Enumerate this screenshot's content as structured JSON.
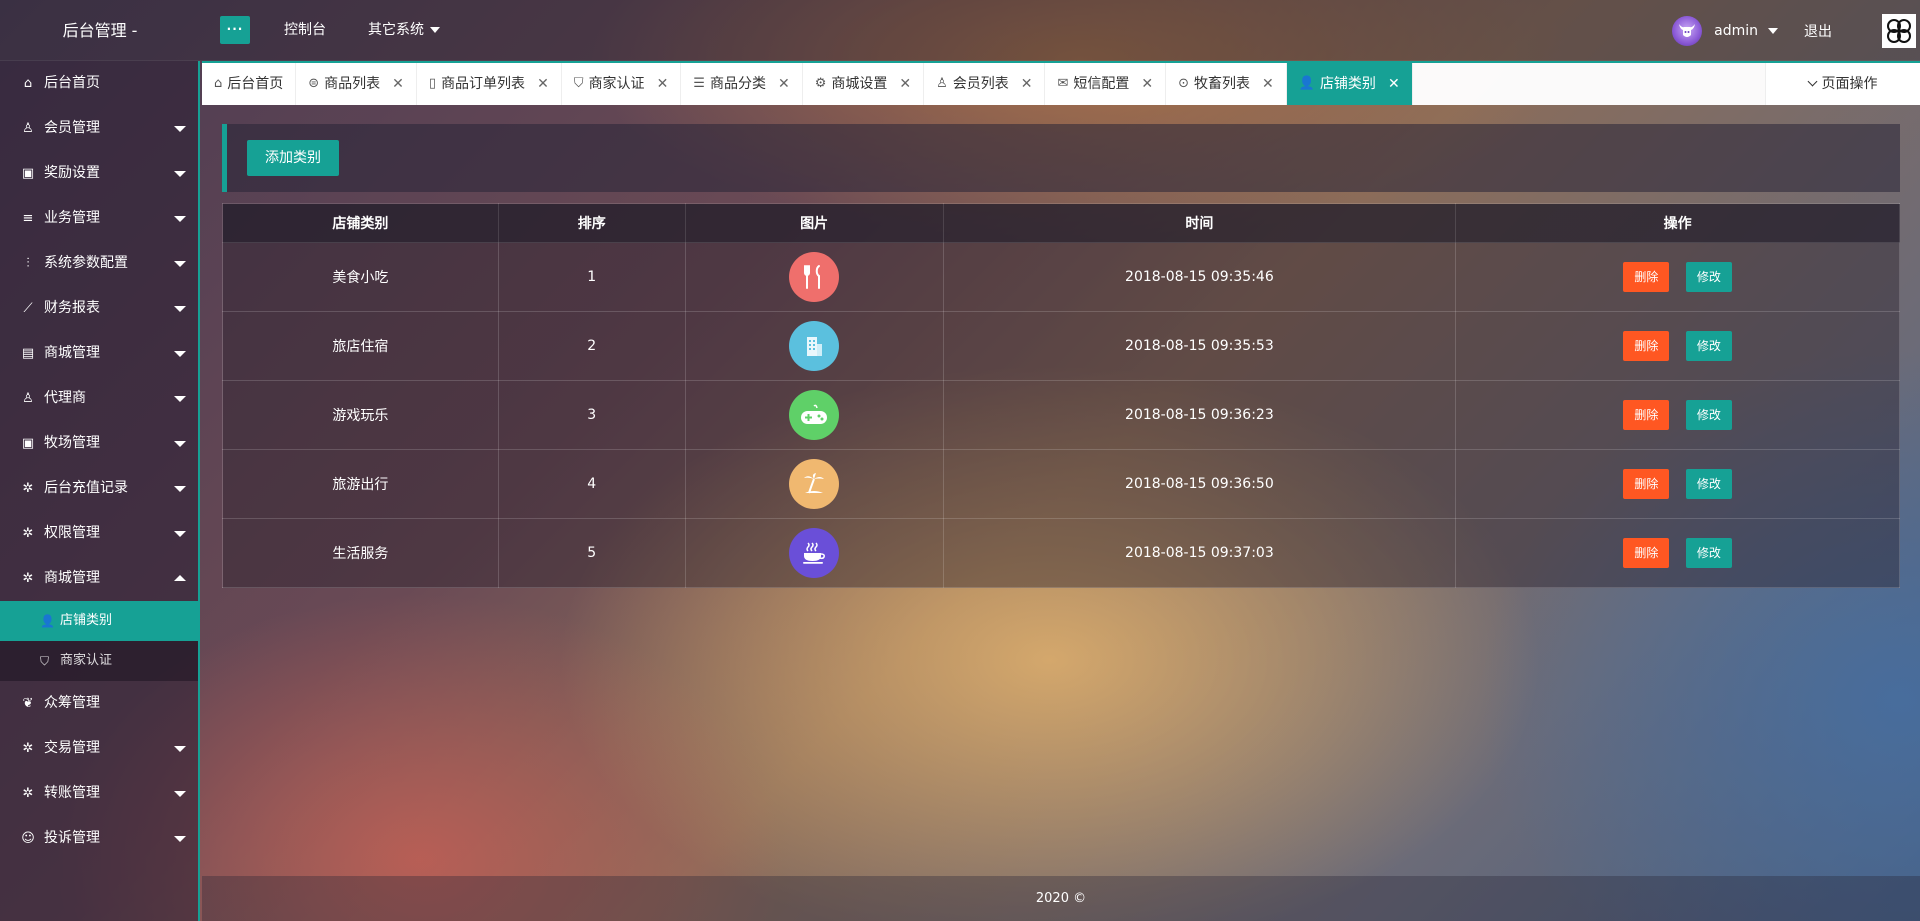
{
  "header": {
    "title": "后台管理 -",
    "menu_toggle": "···",
    "nav": [
      "控制台",
      "其它系统"
    ],
    "username": "admin",
    "logout": "退出"
  },
  "sidebar": {
    "items": [
      {
        "label": "后台首页",
        "icon": "home-icon",
        "glyph": "⌂"
      },
      {
        "label": "会员管理",
        "icon": "user-icon",
        "glyph": "♙"
      },
      {
        "label": "奖励设置",
        "icon": "gift-icon",
        "glyph": "▣"
      },
      {
        "label": "业务管理",
        "icon": "list-icon",
        "glyph": "≡"
      },
      {
        "label": "系统参数配置",
        "icon": "sliders-icon",
        "glyph": "⫶"
      },
      {
        "label": "财务报表",
        "icon": "chart-icon",
        "glyph": "⟋"
      },
      {
        "label": "商城管理",
        "icon": "shop-icon",
        "glyph": "▤"
      },
      {
        "label": "代理商",
        "icon": "agent-icon",
        "glyph": "♙"
      },
      {
        "label": "牧场管理",
        "icon": "gift-icon",
        "glyph": "▣"
      },
      {
        "label": "后台充值记录",
        "icon": "gear-icon",
        "glyph": "✲"
      },
      {
        "label": "权限管理",
        "icon": "gear-icon",
        "glyph": "✲"
      },
      {
        "label": "商城管理",
        "icon": "gear-icon",
        "glyph": "✲"
      }
    ],
    "sub_items": [
      {
        "label": "店铺类别",
        "icon": "user-icon",
        "glyph": "👤"
      },
      {
        "label": "商家认证",
        "icon": "shield-icon",
        "glyph": "⛉"
      }
    ],
    "bottom_items": [
      {
        "label": "众筹管理",
        "icon": "crowdfund-icon",
        "glyph": "❦"
      },
      {
        "label": "交易管理",
        "icon": "gear-icon",
        "glyph": "✲"
      },
      {
        "label": "转账管理",
        "icon": "gear-icon",
        "glyph": "✲"
      },
      {
        "label": "投诉管理",
        "icon": "complaint-icon",
        "glyph": "☺"
      }
    ]
  },
  "tabs": [
    {
      "label": "后台首页",
      "glyph": "⌂"
    },
    {
      "label": "商品列表",
      "glyph": "⊜"
    },
    {
      "label": "商品订单列表",
      "glyph": "▯"
    },
    {
      "label": "商家认证",
      "glyph": "⛉"
    },
    {
      "label": "商品分类",
      "glyph": "☰"
    },
    {
      "label": "商城设置",
      "glyph": "⚙"
    },
    {
      "label": "会员列表",
      "glyph": "♙"
    },
    {
      "label": "短信配置",
      "glyph": "✉"
    },
    {
      "label": "牧畜列表",
      "glyph": "⊙"
    },
    {
      "label": "店铺类别",
      "glyph": "👤"
    }
  ],
  "tab_close": "✕",
  "page_ops": "页面操作",
  "toolbar": {
    "add_label": "添加类别"
  },
  "table": {
    "headers": [
      "店铺类别",
      "排序",
      "图片",
      "时间",
      "操作"
    ],
    "delete_label": "删除",
    "edit_label": "修改",
    "rows": [
      {
        "name": "美食小吃",
        "order": "1",
        "icon": "utensils-icon",
        "glyph": "🍴",
        "color": "#ef6f6c",
        "time": "2018-08-15 09:35:46"
      },
      {
        "name": "旅店住宿",
        "order": "2",
        "icon": "building-icon",
        "glyph": "🏢",
        "color": "#5bc0de",
        "time": "2018-08-15 09:35:53"
      },
      {
        "name": "游戏玩乐",
        "order": "3",
        "icon": "gamepad-icon",
        "glyph": "🎮",
        "color": "#5fd068",
        "time": "2018-08-15 09:36:23"
      },
      {
        "name": "旅游出行",
        "order": "4",
        "icon": "palm-tree-icon",
        "glyph": "🌴",
        "color": "#f0b870",
        "time": "2018-08-15 09:36:50"
      },
      {
        "name": "生活服务",
        "order": "5",
        "icon": "coffee-icon",
        "glyph": "☕",
        "color": "#6a4fd8",
        "time": "2018-08-15 09:37:03"
      }
    ]
  },
  "footer": "2020 ©"
}
